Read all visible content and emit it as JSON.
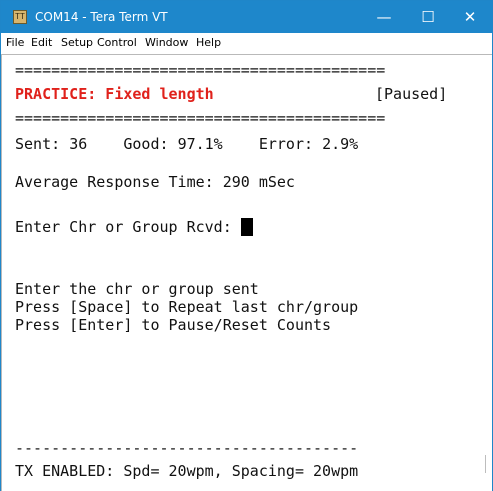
{
  "window": {
    "icon_text": "TT",
    "title": "COM14 - Tera Term VT",
    "controls": {
      "minimize": "—",
      "maximize": "☐",
      "close": "✕"
    }
  },
  "menu": {
    "items": [
      "File",
      "Edit",
      "Setup",
      "Control",
      "Window",
      "Help"
    ]
  },
  "terminal": {
    "separator": "=========================================",
    "mode_label": "PRACTICE: Fixed length",
    "status": "[Paused]",
    "stats": {
      "sent_label": "Sent:",
      "sent": "36",
      "good_label": "Good:",
      "good": "97.1%",
      "error_label": "Error:",
      "error": "2.9%"
    },
    "response_label": "Average Response Time:",
    "response_value": "290 mSec",
    "prompt": "Enter Chr or Group Rcvd:",
    "instructions": [
      "Enter the chr or group sent",
      "Press [Space] to Repeat last chr/group",
      "Press [Enter] to Pause/Reset Counts"
    ],
    "bottom_separator": "--------------------------------------",
    "tx_status": "TX ENABLED: Spd= 20wpm, Spacing= 20wpm"
  }
}
